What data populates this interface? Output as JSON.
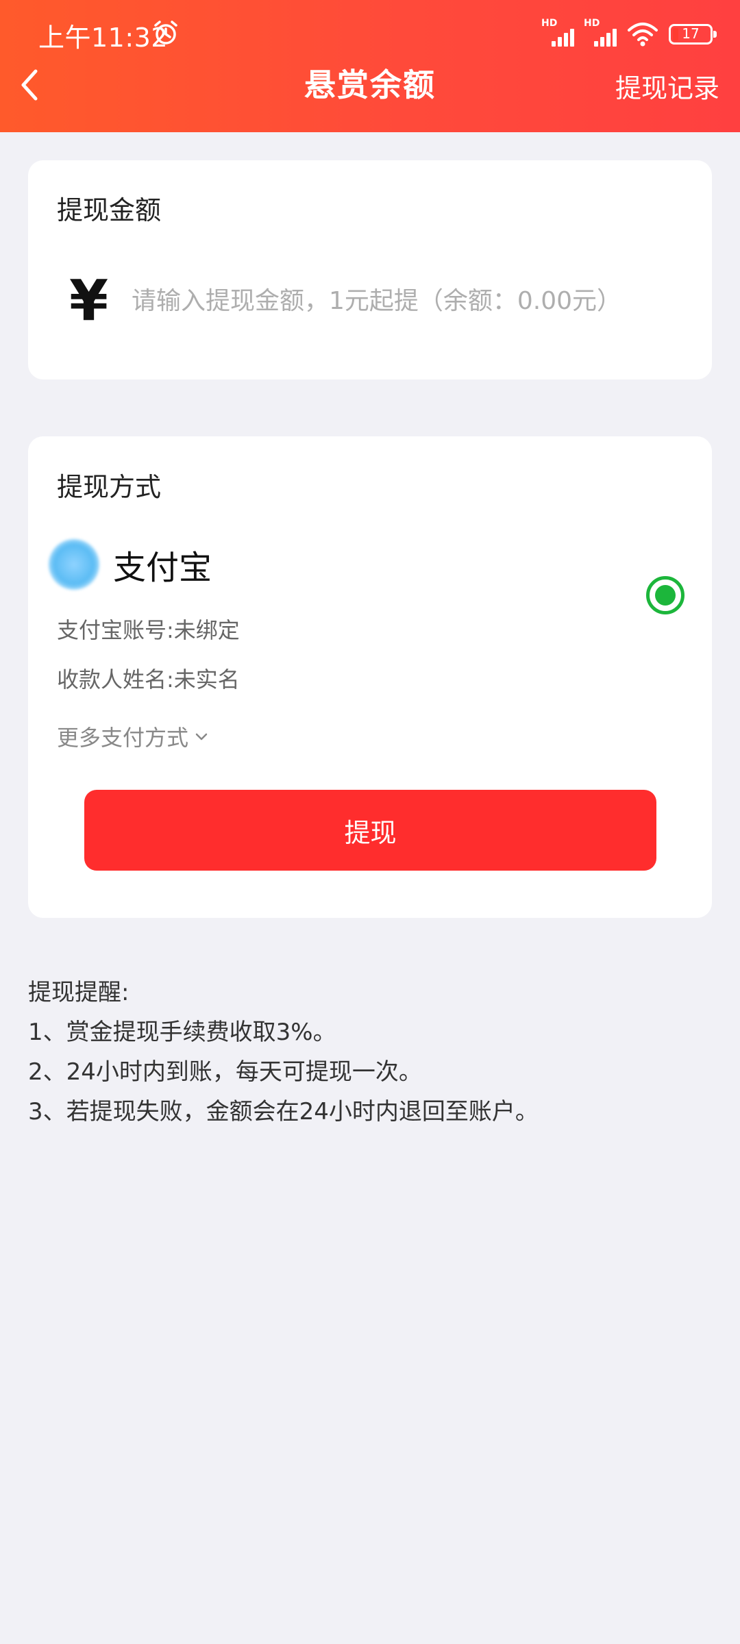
{
  "status_bar": {
    "time": "上午11:32",
    "signal_label": "HD",
    "battery_level": "17"
  },
  "header": {
    "title": "悬赏余额",
    "history_link": "提现记录"
  },
  "amount_card": {
    "title": "提现金额",
    "currency_symbol": "¥",
    "placeholder": "请输入提现金额，1元起提（余额：0.00元）"
  },
  "method_card": {
    "title": "提现方式",
    "method_name": "支付宝",
    "account_line": "支付宝账号:未绑定",
    "payee_line": "收款人姓名:未实名",
    "more_methods": "更多支付方式",
    "withdraw_button": "提现"
  },
  "notes": {
    "title": "提现提醒:",
    "items": [
      "1、赏金提现手续费收取3%。",
      "2、24小时内到账，每天可提现一次。",
      "3、若提现失败，金额会在24小时内退回至账户。"
    ]
  },
  "colors": {
    "header_start": "#ff5a2b",
    "header_end": "#ff4040",
    "button": "#ff2d2d",
    "radio_selected": "#1cb63b",
    "background": "#f1f1f6"
  }
}
